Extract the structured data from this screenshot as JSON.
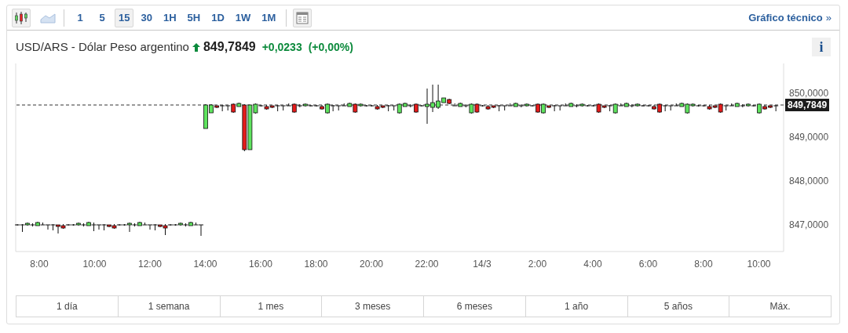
{
  "toolbar": {
    "chart_types": [
      {
        "kind": "candles",
        "selected": true
      },
      {
        "kind": "area",
        "selected": false
      }
    ],
    "intervals": [
      {
        "label": "1",
        "selected": false
      },
      {
        "label": "5",
        "selected": false
      },
      {
        "label": "15",
        "selected": true
      },
      {
        "label": "30",
        "selected": false
      },
      {
        "label": "1H",
        "selected": false
      },
      {
        "label": "5H",
        "selected": false
      },
      {
        "label": "1D",
        "selected": false
      },
      {
        "label": "1W",
        "selected": false
      },
      {
        "label": "1M",
        "selected": false
      }
    ],
    "link": {
      "label": "Gráfico técnico",
      "arrow": "»"
    }
  },
  "quote": {
    "title": "USD/ARS - Dólar Peso argentino",
    "rising": true,
    "price": "849,7849",
    "change": "+0,0233",
    "change_percent": "(+0,00%)",
    "info": "i"
  },
  "chart": {
    "y_axis": [
      "850,0000",
      "849,0000",
      "848,0000",
      "847,0000"
    ],
    "current_price": "849,7849",
    "x_axis": [
      "8:00",
      "10:00",
      "12:00",
      "14:00",
      "16:00",
      "18:00",
      "20:00",
      "22:00",
      "14/3",
      "2:00",
      "4:00",
      "6:00",
      "8:00",
      "10:00"
    ]
  },
  "ranges": [
    {
      "label": "1 día",
      "selected": false
    },
    {
      "label": "1 semana",
      "selected": false
    },
    {
      "label": "1 mes",
      "selected": false
    },
    {
      "label": "3 meses",
      "selected": false
    },
    {
      "label": "6 meses",
      "selected": false
    },
    {
      "label": "1 año",
      "selected": false
    },
    {
      "label": "5 años",
      "selected": false
    },
    {
      "label": "Máx.",
      "selected": false
    }
  ]
}
